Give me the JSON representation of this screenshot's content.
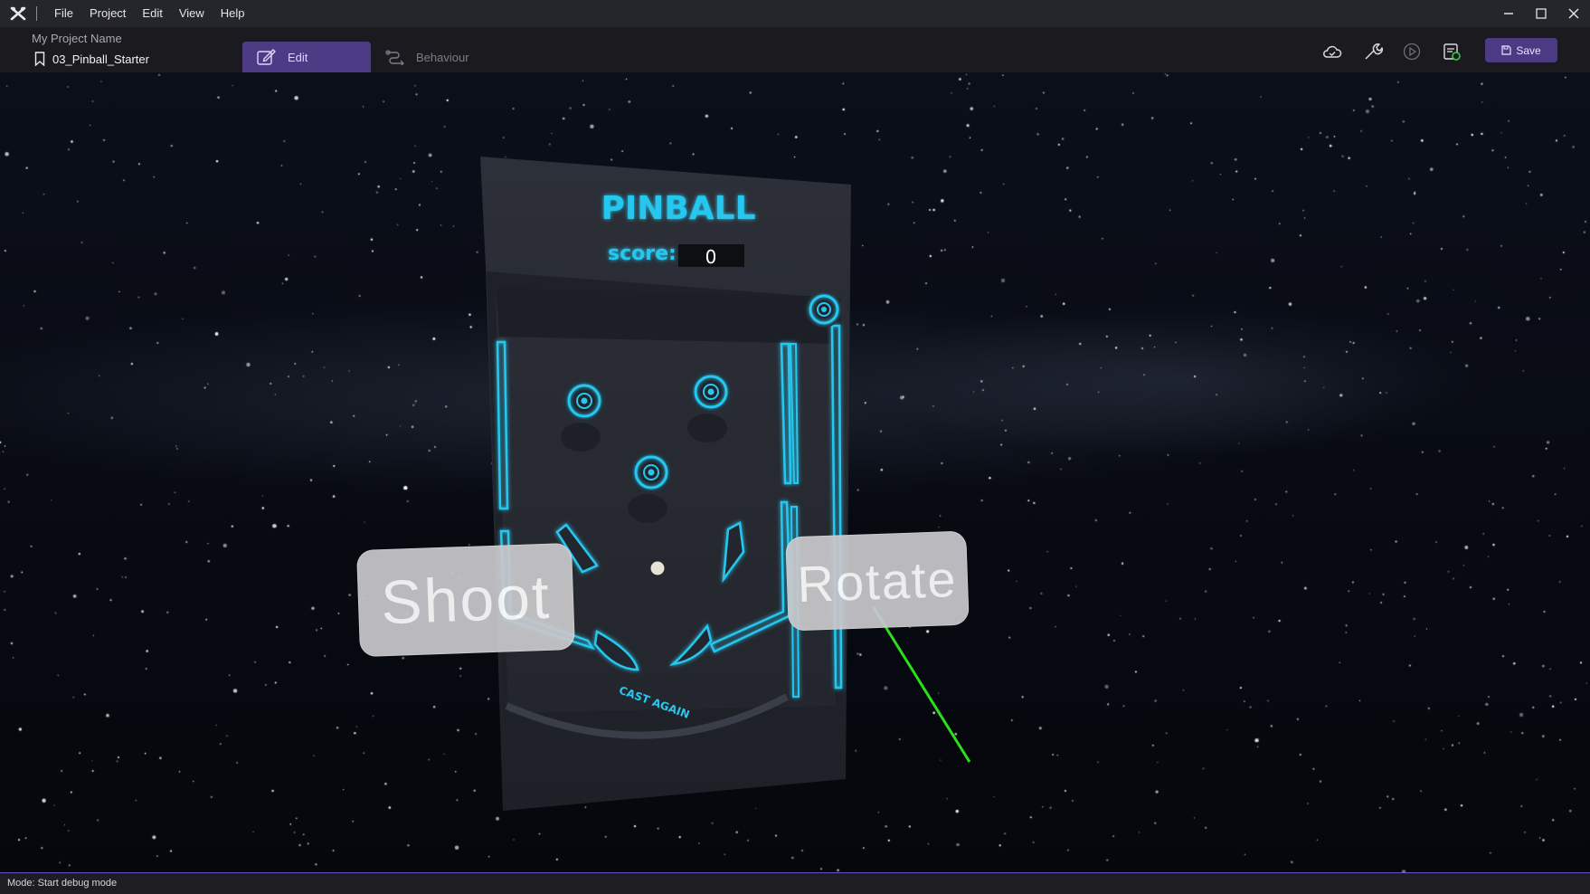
{
  "menu": {
    "items": [
      "File",
      "Project",
      "Edit",
      "View",
      "Help"
    ]
  },
  "project": {
    "name": "My Project Name",
    "scene": "03_Pinball_Starter"
  },
  "modes": {
    "edit_label": "Edit",
    "behaviour_label": "Behaviour",
    "active": "Edit"
  },
  "toolbar": {
    "save_label": "Save",
    "icons": [
      "cloud-icon",
      "wrench-icon",
      "play-icon",
      "publish-icon"
    ]
  },
  "scene": {
    "title": "PINBALL",
    "score_label": "score:",
    "score_value": "0",
    "logo_text": "CAST AGAIN",
    "shoot_label": "Shoot",
    "rotate_label": "Rotate"
  },
  "status": {
    "text": "Mode: Start debug mode"
  },
  "colors": {
    "accent": "#4e3b86",
    "neon": "#27c7ef",
    "pointer": "#2be01b"
  }
}
